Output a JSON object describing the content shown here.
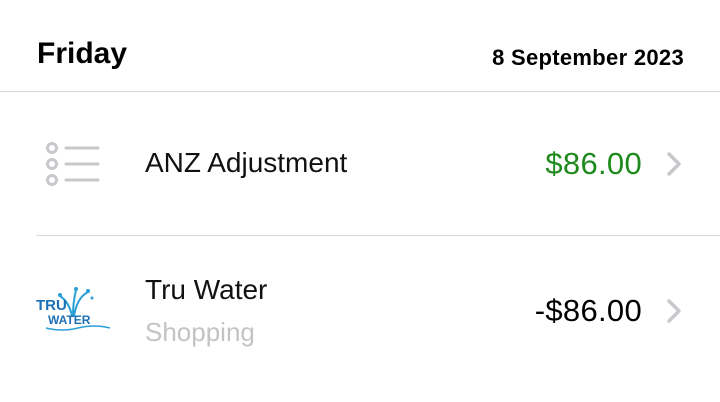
{
  "day": {
    "title": "Friday",
    "date": "8 September 2023"
  },
  "transactions": [
    {
      "name": "ANZ Adjustment",
      "category": "",
      "amount": "$86.00",
      "amount_color": "#1e8a1e",
      "icon": "list-icon"
    },
    {
      "name": "Tru Water",
      "category": "Shopping",
      "amount": "-$86.00",
      "amount_color": "#000000",
      "icon": "tru-water-logo",
      "logo_text_top": "TRU",
      "logo_text_bottom": "WATER"
    }
  ],
  "colors": {
    "positive": "#1e8a1e",
    "secondary_text": "#c3c3c6",
    "chevron": "#c7c7cc",
    "divider": "#d9d9d9"
  }
}
